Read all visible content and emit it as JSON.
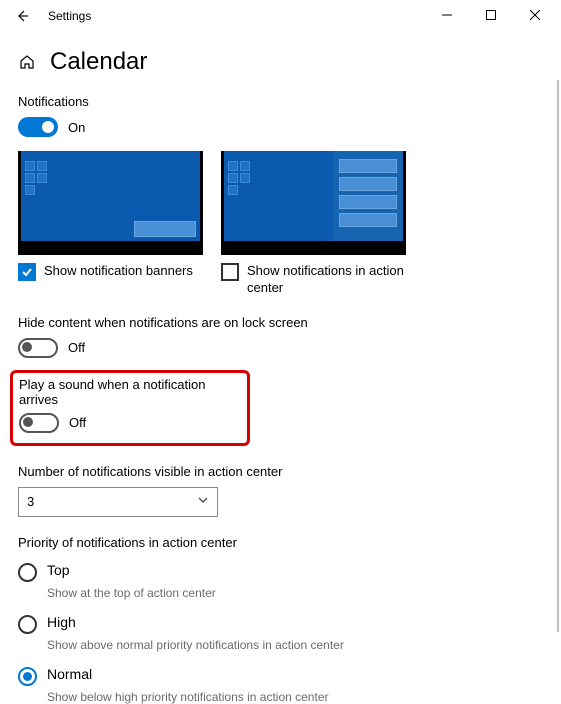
{
  "window": {
    "title": "Settings"
  },
  "page": {
    "title": "Calendar"
  },
  "notifications": {
    "label": "Notifications",
    "toggle_state": "On"
  },
  "banners": {
    "label": "Show notification banners",
    "checked": true
  },
  "action_center_preview": {
    "label": "Show notifications in action center",
    "checked": false
  },
  "hide_content": {
    "label": "Hide content when notifications are on lock screen",
    "toggle_state": "Off"
  },
  "play_sound": {
    "label": "Play a sound when a notification arrives",
    "toggle_state": "Off"
  },
  "num_visible": {
    "label": "Number of notifications visible in action center",
    "value": "3"
  },
  "priority": {
    "label": "Priority of notifications in action center",
    "options": [
      {
        "label": "Top",
        "desc": "Show at the top of action center",
        "selected": false
      },
      {
        "label": "High",
        "desc": "Show above normal priority notifications in action center",
        "selected": false
      },
      {
        "label": "Normal",
        "desc": "Show below high priority notifications in action center",
        "selected": true
      }
    ]
  }
}
